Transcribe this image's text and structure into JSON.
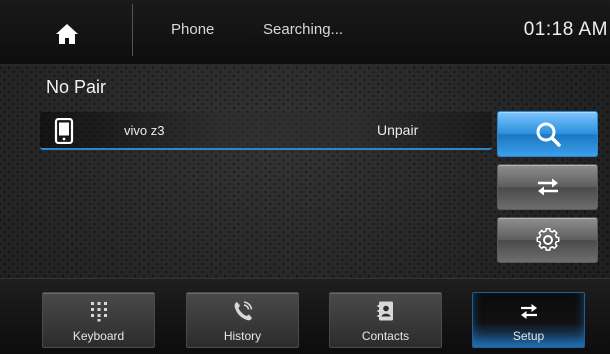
{
  "header": {
    "home_icon": "home-icon",
    "source": "Phone",
    "status": "Searching...",
    "time": "01:18 AM"
  },
  "section": {
    "label": "No Pair"
  },
  "device": {
    "icon": "phone-device-icon",
    "name": "vivo z3",
    "action": "Unpair"
  },
  "side_buttons": [
    {
      "name": "search",
      "icon": "search-icon",
      "active": true
    },
    {
      "name": "switch",
      "icon": "swap-arrows-icon",
      "active": false
    },
    {
      "name": "settings",
      "icon": "gear-icon",
      "active": false
    }
  ],
  "tabs": [
    {
      "label": "Keyboard",
      "icon": "keypad-icon",
      "active": false
    },
    {
      "label": "History",
      "icon": "phone-call-icon",
      "active": false
    },
    {
      "label": "Contacts",
      "icon": "contact-book-icon",
      "active": false
    },
    {
      "label": "Setup",
      "icon": "swap-arrows-icon",
      "active": true
    }
  ],
  "colors": {
    "accent": "#2b8fdb",
    "active_tab_glow": "#1c5a8e",
    "device_underline": "#2e86c9"
  }
}
